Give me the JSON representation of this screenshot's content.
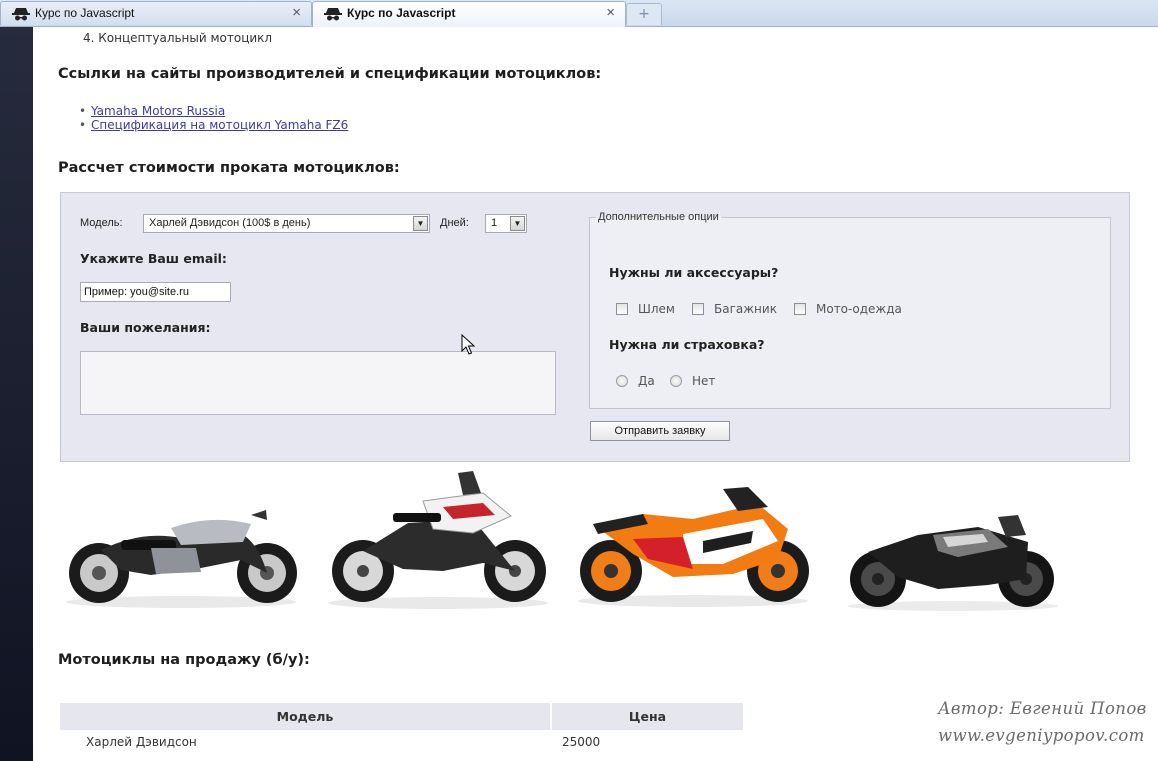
{
  "tabs": [
    {
      "title": "Курс по Javascript",
      "close": "×"
    },
    {
      "title": "Курс по Javascript",
      "close": "×"
    }
  ],
  "new_tab": "+",
  "list_item": "4.  Концептуальный мотоцикл",
  "links_heading": "Ссылки на сайты производителей и спецификации мотоциклов:",
  "links": [
    "Yamaha Motors Russia",
    "Спецификация на мотоцикл Yamaha FZ6"
  ],
  "calc_heading": "Рассчет стоимости проката мотоциклов:",
  "form": {
    "model_label": "Модель:",
    "model_value": "Харлей Дэвидсон (100$ в день)",
    "days_label": "Дней:",
    "days_value": "1",
    "email_label": "Укажите Ваш email:",
    "email_value": "Пример: you@site.ru",
    "wishes_label": "Ваши пожелания:",
    "submit": "Отправить заявку"
  },
  "options": {
    "legend": "Дополнительные опции",
    "accessories_q": "Нужны ли аксессуары?",
    "accessories": [
      "Шлем",
      "Багажник",
      "Мото-одежда"
    ],
    "insurance_q": "Нужна ли страховка?",
    "insurance": [
      "Да",
      "Нет"
    ]
  },
  "sale_heading": "Мотоциклы на продажу (б/у):",
  "table": {
    "headers": [
      "Модель",
      "Цена"
    ],
    "rows": [
      [
        "Харлей Дэвидсон",
        "25000"
      ]
    ]
  },
  "author": {
    "line1": "Автор: Евгений Попов",
    "line2": "www.evgeniypopov.com"
  }
}
